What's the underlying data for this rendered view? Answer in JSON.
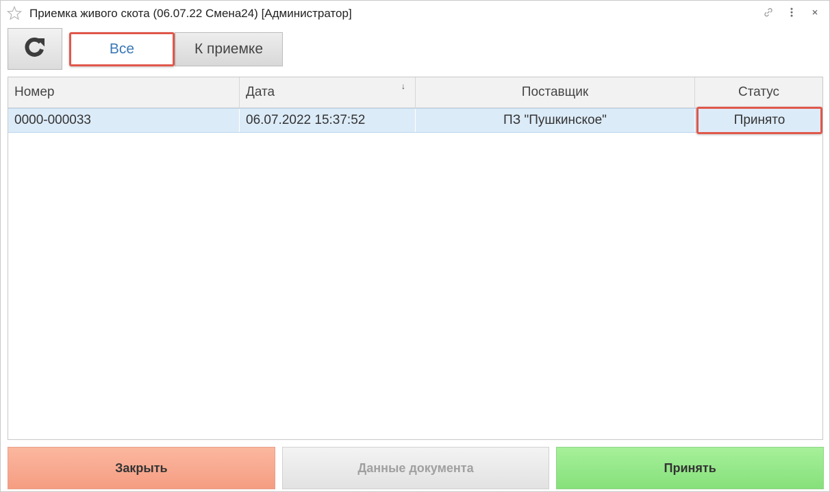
{
  "window": {
    "title": "Приемка живого скота (06.07.22 Смена24) [Администратор]"
  },
  "toolbar": {
    "refresh_icon": "refresh-icon",
    "filters": [
      {
        "label": "Все",
        "active": true
      },
      {
        "label": "К приемке",
        "active": false
      }
    ]
  },
  "table": {
    "columns": [
      "Номер",
      "Дата",
      "Поставщик",
      "Статус"
    ],
    "sort_indicator": "↓",
    "rows": [
      {
        "number": "0000-000033",
        "date": "06.07.2022 15:37:52",
        "supplier": "ПЗ \"Пушкинское\"",
        "status": "Принято"
      }
    ]
  },
  "actions": {
    "close_label": "Закрыть",
    "document_label": "Данные документа",
    "accept_label": "Принять"
  },
  "colors": {
    "highlight": "#e0574a",
    "active_filter_text": "#3a78b5",
    "selected_row": "#dcebf8",
    "close_button": "#f59d82",
    "accept_button": "#86e07a"
  }
}
